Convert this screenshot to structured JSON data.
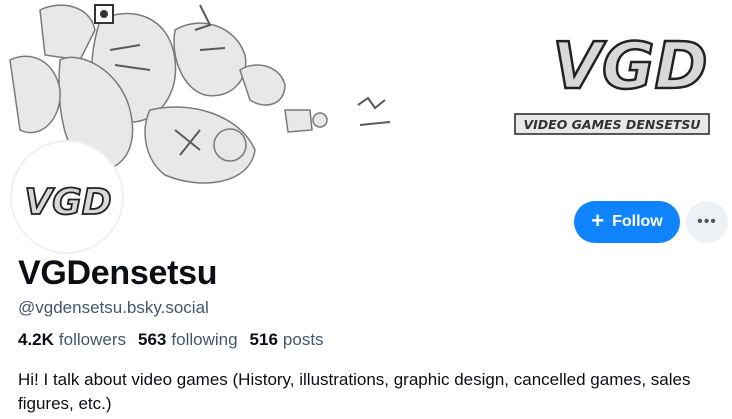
{
  "banner": {
    "logo_text": "VGD",
    "logo_subtitle": "VIDEO GAMES DENSETSU"
  },
  "avatar": {
    "logo_text": "VGD"
  },
  "actions": {
    "follow_label": "Follow",
    "more_icon": "ellipsis-icon",
    "follow_color": "#1083fe"
  },
  "profile": {
    "display_name": "VGDensetsu",
    "handle": "@vgdensetsu.bsky.social",
    "followers_count": "4.2K",
    "followers_label": "followers",
    "following_count": "563",
    "following_label": "following",
    "posts_count": "516",
    "posts_label": "posts",
    "bio": "Hi! I talk about video games (History, illustrations, graphic design, cancelled games, sales figures, etc.)"
  }
}
